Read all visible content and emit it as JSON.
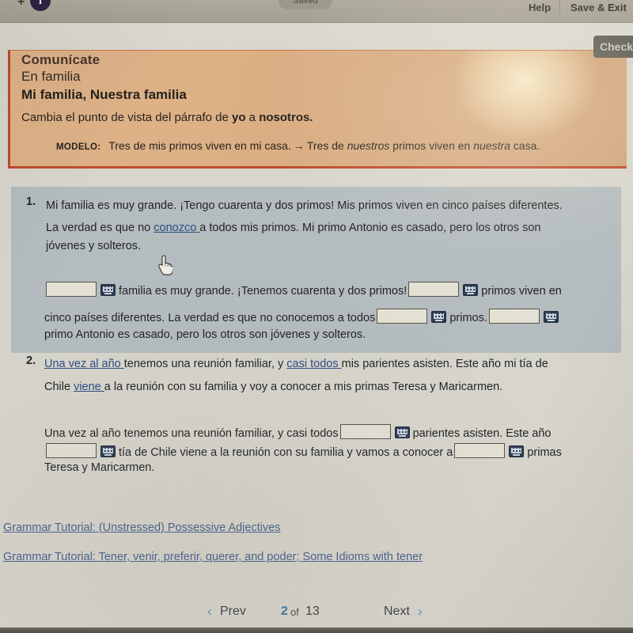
{
  "topbar": {
    "brand_icon": "circle-i-logo",
    "saved_badge": "Saved",
    "help_label": "Help",
    "save_exit_label": "Save & Exit"
  },
  "toolbar": {
    "check_label": "Check"
  },
  "banner": {
    "kicker": "Comunícate",
    "subtitle": "En familia",
    "title": "Mi familia, Nuestra familia",
    "instruction_pre": "Cambia el punto de vista del párrafo de ",
    "instruction_bold1": "yo",
    "instruction_mid": " a ",
    "instruction_bold2": "nosotros.",
    "modelo_label": "MODELO:",
    "modelo_source": "Tres de mis primos viven en mi casa.",
    "modelo_arrow": "→",
    "modelo_target_pre": "Tres de ",
    "modelo_target_it1": "nuestros",
    "modelo_target_mid": " primos viven en ",
    "modelo_target_it2": "nuestra",
    "modelo_target_end": " casa."
  },
  "questions": [
    {
      "number": "1.",
      "prompt_lines": [
        [
          {
            "t": "Mi familia es muy grande. ¡Tengo cuarenta y dos primos! Mis primos viven en cinco países diferentes.",
            "s": "plain"
          }
        ],
        [
          {
            "t": "La verdad es que no ",
            "s": "plain"
          },
          {
            "t": "conozco ",
            "s": "underline"
          },
          {
            "t": "a todos mis primos. Mi primo Antonio es casado, pero los otros son",
            "s": "plain"
          }
        ],
        [
          {
            "t": "jóvenes y solteros.",
            "s": "plain"
          }
        ]
      ],
      "answer_lines": [
        [
          {
            "t": "",
            "s": "blank"
          },
          {
            "t": "familia es muy grande. ¡Tenemos cuarenta y dos primos!",
            "s": "plain"
          },
          {
            "t": "",
            "s": "blank"
          },
          {
            "t": "primos viven en",
            "s": "plain"
          }
        ],
        [
          {
            "t": "cinco países diferentes. La verdad es que no conocemos a todos",
            "s": "plain"
          },
          {
            "t": "",
            "s": "blank"
          },
          {
            "t": "primos.",
            "s": "plain"
          },
          {
            "t": "",
            "s": "blank"
          }
        ],
        [
          {
            "t": "primo Antonio es casado, pero los otros son jóvenes y solteros.",
            "s": "plain"
          }
        ]
      ]
    },
    {
      "number": "2.",
      "prompt_lines": [
        [
          {
            "t": "Una vez al año ",
            "s": "underline"
          },
          {
            "t": "tenemos una reunión familiar, y ",
            "s": "plain"
          },
          {
            "t": "casi todos ",
            "s": "underline"
          },
          {
            "t": "mis parientes asisten. Este año mi tía de",
            "s": "plain"
          }
        ],
        [
          {
            "t": "Chile ",
            "s": "plain"
          },
          {
            "t": "viene ",
            "s": "underline"
          },
          {
            "t": "a la reunión con su familia y voy a conocer a mis primas Teresa y Maricarmen.",
            "s": "plain"
          }
        ]
      ],
      "answer_lines": [
        [
          {
            "t": "Una vez al año tenemos una reunión familiar, y casi todos",
            "s": "plain"
          },
          {
            "t": "",
            "s": "blank"
          },
          {
            "t": "parientes asisten. Este año",
            "s": "plain"
          }
        ],
        [
          {
            "t": "",
            "s": "blank"
          },
          {
            "t": "tía de Chile viene a la reunión con su familia y vamos a conocer a",
            "s": "plain"
          },
          {
            "t": "",
            "s": "blank"
          },
          {
            "t": "primas",
            "s": "plain"
          }
        ],
        [
          {
            "t": "Teresa y Maricarmen.",
            "s": "plain"
          }
        ]
      ]
    }
  ],
  "tutorial_links": [
    "Grammar Tutorial: (Unstressed) Possessive Adjectives",
    "Grammar Tutorial: Tener, venir, preferir, querer, and poder; Some Idioms with tener"
  ],
  "nav": {
    "prev_label": "Prev",
    "prev_chevron": "‹",
    "page_current": "2",
    "page_of": "of",
    "page_total": "13",
    "grid_icon": "grid-menu-icon",
    "next_label": "Next",
    "next_chevron": "›"
  },
  "cursor": {
    "type": "pointing-hand-cursor"
  },
  "colors": {
    "banner_bg": "#dfb186",
    "banner_rule": "#c0492e",
    "highlight_bg": "#b3bcc0",
    "link_blue": "#46618f",
    "nav_blue": "#3d77a8"
  }
}
